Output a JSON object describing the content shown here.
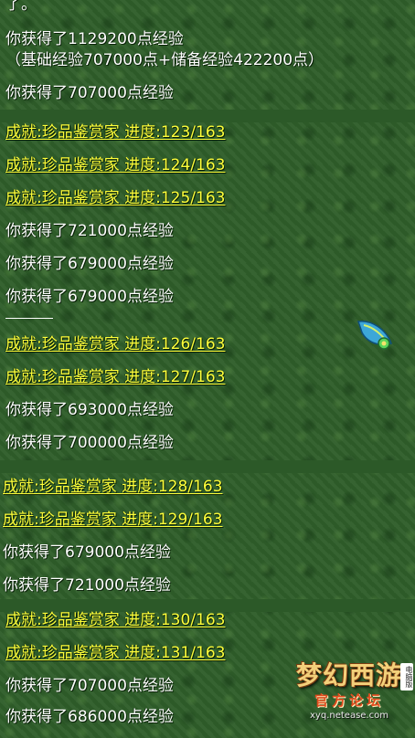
{
  "lines": [
    {
      "text": "了。",
      "style": "white"
    },
    {
      "text": "你获得了1129200点经验",
      "style": "white"
    },
    {
      "text": "（基础经验707000点+储备经验422200点）",
      "style": "white"
    },
    {
      "text": "你获得了707000点经验",
      "style": "white"
    },
    {
      "text": "成就:珍品鉴赏家  进度:123/163",
      "style": "gold"
    },
    {
      "text": "成就:珍品鉴赏家  进度:124/163",
      "style": "gold"
    },
    {
      "text": "成就:珍品鉴赏家  进度:125/163",
      "style": "gold"
    },
    {
      "text": "你获得了721000点经验",
      "style": "white"
    },
    {
      "text": "你获得了679000点经验",
      "style": "white"
    },
    {
      "text": "你获得了679000点经验",
      "style": "white"
    },
    {
      "text": "成就:珍品鉴赏家  进度:126/163",
      "style": "gold"
    },
    {
      "text": "成就:珍品鉴赏家  进度:127/163",
      "style": "gold"
    },
    {
      "text": "你获得了693000点经验",
      "style": "white"
    },
    {
      "text": "你获得了700000点经验",
      "style": "white"
    },
    {
      "text": "成就:珍品鉴赏家  进度:128/163",
      "style": "gold"
    },
    {
      "text": "成就:珍品鉴赏家  进度:129/163",
      "style": "gold"
    },
    {
      "text": "你获得了679000点经验",
      "style": "white"
    },
    {
      "text": "你获得了721000点经验",
      "style": "white"
    },
    {
      "text": "成就:珍品鉴赏家  进度:130/163",
      "style": "gold"
    },
    {
      "text": "成就:珍品鉴赏家  进度:131/163",
      "style": "gold"
    },
    {
      "text": "你获得了707000点经验",
      "style": "white"
    },
    {
      "text": "你获得了686000点经验",
      "style": "white"
    }
  ],
  "logo": {
    "name": "梦幻西游",
    "badge": "电脑版",
    "subtitle": "官方论坛",
    "url": "xyq.netease.com"
  },
  "colors": {
    "background": "#2f5e2a",
    "system_text": "#ffffff",
    "achievement_text": "#ffff3a"
  },
  "icons": [
    "feather-leaf-icon"
  ]
}
